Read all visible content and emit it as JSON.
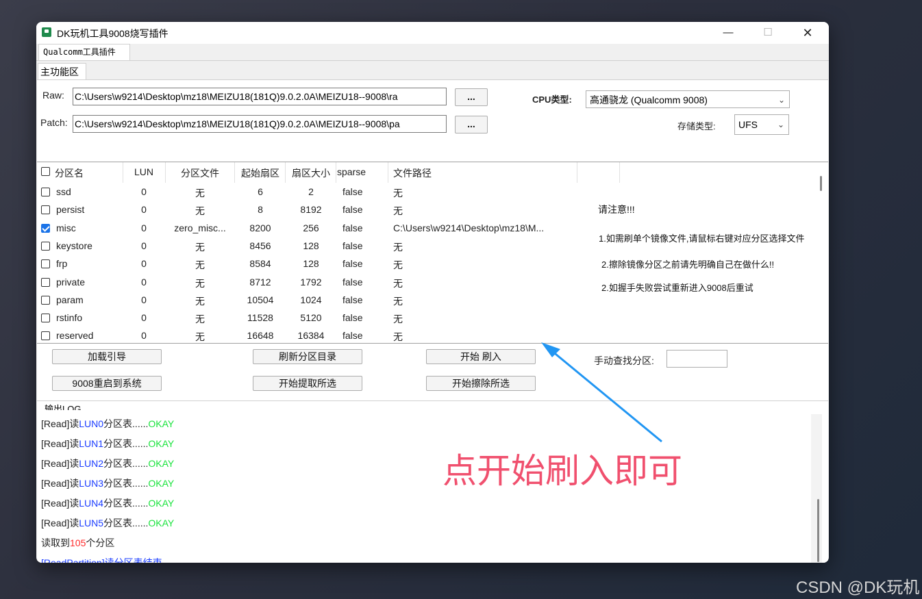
{
  "window": {
    "title": "DK玩机工具9008烧写插件",
    "min_glyph": "—",
    "max_glyph": "☐",
    "close_glyph": "✕"
  },
  "tabs": {
    "top_tab": "Qualcomm工具插件",
    "panel_tab": "主功能区"
  },
  "raw": {
    "label": "Raw:",
    "value": "C:\\Users\\w9214\\Desktop\\mz18\\MEIZU18(181Q)9.0.2.0A\\MEIZU18--9008\\ra",
    "browse": "..."
  },
  "patch": {
    "label": "Patch:",
    "value": "C:\\Users\\w9214\\Desktop\\mz18\\MEIZU18(181Q)9.0.2.0A\\MEIZU18--9008\\pa",
    "browse": "..."
  },
  "cpu": {
    "label": "CPU类型:",
    "value": "高通骁龙 (Qualcomm 9008)"
  },
  "storage": {
    "label": "存储类型:",
    "value": "UFS"
  },
  "table": {
    "headers": [
      "分区名",
      "LUN",
      "分区文件",
      "起始扇区",
      "扇区大小",
      "sparse",
      "文件路径"
    ],
    "rows": [
      {
        "checked": false,
        "name": "ssd",
        "lun": "0",
        "file": "无",
        "start": "6",
        "size": "2",
        "sparse": "false",
        "path": "无"
      },
      {
        "checked": false,
        "name": "persist",
        "lun": "0",
        "file": "无",
        "start": "8",
        "size": "8192",
        "sparse": "false",
        "path": "无"
      },
      {
        "checked": true,
        "name": "misc",
        "lun": "0",
        "file": "zero_misc...",
        "start": "8200",
        "size": "256",
        "sparse": "false",
        "path": "C:\\Users\\w9214\\Desktop\\mz18\\M..."
      },
      {
        "checked": false,
        "name": "keystore",
        "lun": "0",
        "file": "无",
        "start": "8456",
        "size": "128",
        "sparse": "false",
        "path": "无"
      },
      {
        "checked": false,
        "name": "frp",
        "lun": "0",
        "file": "无",
        "start": "8584",
        "size": "128",
        "sparse": "false",
        "path": "无"
      },
      {
        "checked": false,
        "name": "private",
        "lun": "0",
        "file": "无",
        "start": "8712",
        "size": "1792",
        "sparse": "false",
        "path": "无"
      },
      {
        "checked": false,
        "name": "param",
        "lun": "0",
        "file": "无",
        "start": "10504",
        "size": "1024",
        "sparse": "false",
        "path": "无"
      },
      {
        "checked": false,
        "name": "rstinfo",
        "lun": "0",
        "file": "无",
        "start": "11528",
        "size": "5120",
        "sparse": "false",
        "path": "无"
      },
      {
        "checked": false,
        "name": "reserved",
        "lun": "0",
        "file": "无",
        "start": "16648",
        "size": "16384",
        "sparse": "false",
        "path": "无"
      }
    ]
  },
  "notice": {
    "title": "请注意!!!",
    "line1": "1.如需刷单个镜像文件,请鼠标右键对应分区选择文件",
    "line2": "2.擦除镜像分区之前请先明确自己在做什么!!",
    "line3": "2.如握手失败尝试重新进入9008后重试"
  },
  "buttons": {
    "load_boot": "加载引导",
    "refresh": "刷新分区目录",
    "start_flash": "开始 刷入",
    "reboot": "9008重启到系统",
    "extract": "开始提取所选",
    "erase": "开始擦除所选"
  },
  "search": {
    "label": "手动查找分区:",
    "value": ""
  },
  "log": {
    "label": "输出LOG....",
    "lines": [
      {
        "prefix": "[Read]读",
        "lun": "LUN0",
        "mid": "分区表......",
        "status": "OKAY"
      },
      {
        "prefix": "[Read]读",
        "lun": "LUN1",
        "mid": "分区表......",
        "status": "OKAY"
      },
      {
        "prefix": "[Read]读",
        "lun": "LUN2",
        "mid": "分区表......",
        "status": "OKAY"
      },
      {
        "prefix": "[Read]读",
        "lun": "LUN3",
        "mid": "分区表......",
        "status": "OKAY"
      },
      {
        "prefix": "[Read]读",
        "lun": "LUN4",
        "mid": "分区表......",
        "status": "OKAY"
      },
      {
        "prefix": "[Read]读",
        "lun": "LUN5",
        "mid": "分区表......",
        "status": "OKAY"
      }
    ],
    "count_prefix": "读取到",
    "count_value": "105",
    "count_suffix": "个分区",
    "end_line": "[ReadPartition]读分区表结束"
  },
  "annotation": "点开始刷入即可",
  "watermark": "CSDN @DK玩机",
  "colors": {
    "arrow": "#2196f3",
    "annotation": "#f0506e"
  }
}
